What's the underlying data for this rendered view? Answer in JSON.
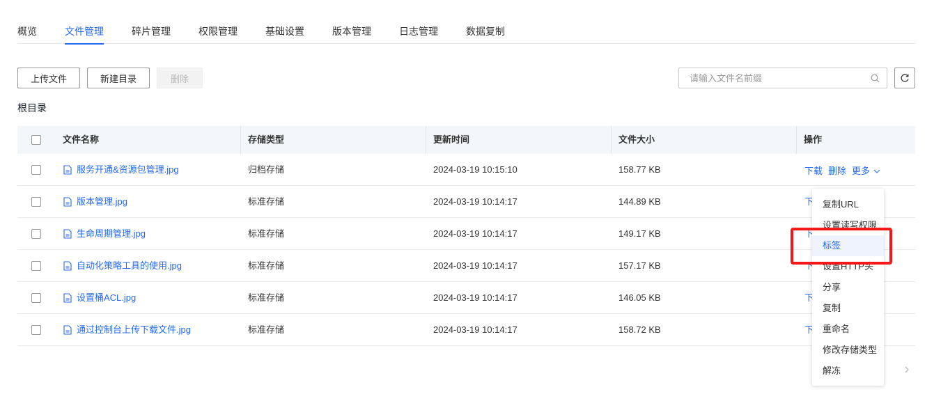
{
  "tabs": [
    {
      "label": "概览",
      "active": false
    },
    {
      "label": "文件管理",
      "active": true
    },
    {
      "label": "碎片管理",
      "active": false
    },
    {
      "label": "权限管理",
      "active": false
    },
    {
      "label": "基础设置",
      "active": false
    },
    {
      "label": "版本管理",
      "active": false
    },
    {
      "label": "日志管理",
      "active": false
    },
    {
      "label": "数据复制",
      "active": false
    }
  ],
  "toolbar": {
    "upload_label": "上传文件",
    "new_dir_label": "新建目录",
    "delete_label": "删除",
    "search_placeholder": "请输入文件名前缀",
    "search_icon": "search-icon",
    "refresh_icon": "refresh-icon"
  },
  "breadcrumb": "根目录",
  "table": {
    "headers": {
      "name": "文件名称",
      "storage": "存储类型",
      "updated": "更新时间",
      "size": "文件大小",
      "actions": "操作"
    },
    "rows": [
      {
        "name": "服务开通&资源包管理.jpg",
        "storage": "归档存储",
        "updated": "2024-03-19 10:15:10",
        "size": "158.77 KB"
      },
      {
        "name": "版本管理.jpg",
        "storage": "标准存储",
        "updated": "2024-03-19 10:14:17",
        "size": "144.89 KB"
      },
      {
        "name": "生命周期管理.jpg",
        "storage": "标准存储",
        "updated": "2024-03-19 10:14:17",
        "size": "149.17 KB"
      },
      {
        "name": "自动化策略工具的使用.jpg",
        "storage": "标准存储",
        "updated": "2024-03-19 10:14:17",
        "size": "157.17 KB"
      },
      {
        "name": "设置桶ACL.jpg",
        "storage": "标准存储",
        "updated": "2024-03-19 10:14:17",
        "size": "146.05 KB"
      },
      {
        "name": "通过控制台上传下载文件.jpg",
        "storage": "标准存储",
        "updated": "2024-03-19 10:14:17",
        "size": "158.72 KB"
      }
    ],
    "actions": {
      "download": "下载",
      "delete": "删除",
      "more": "更多",
      "download_partial": "下"
    }
  },
  "more_menu": {
    "items": [
      {
        "label": "复制URL"
      },
      {
        "label": "设置读写权限"
      },
      {
        "label": "标签",
        "hover": true
      },
      {
        "label": "设置HTTP头"
      },
      {
        "label": "分享"
      },
      {
        "label": "复制"
      },
      {
        "label": "重命名"
      },
      {
        "label": "修改存储类型"
      },
      {
        "label": "解冻"
      }
    ]
  },
  "colors": {
    "accent": "#2468f2",
    "highlight": "#f41818",
    "header_bg": "#f3f6fb"
  }
}
